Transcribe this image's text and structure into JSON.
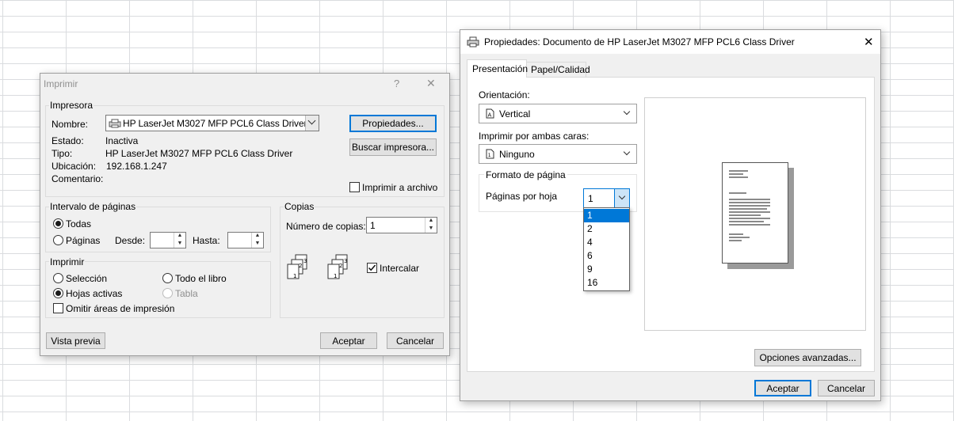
{
  "print_dialog": {
    "title": "Imprimir",
    "help_glyph": "?",
    "close_glyph": "✕",
    "printer": {
      "group_label": "Impresora",
      "name_label": "Nombre:",
      "name_value": "HP LaserJet M3027 MFP PCL6 Class Driver",
      "status_label": "Estado:",
      "status_value": "Inactiva",
      "type_label": "Tipo:",
      "type_value": "HP LaserJet M3027 MFP PCL6 Class Driver",
      "location_label": "Ubicación:",
      "location_value": "192.168.1.247",
      "comment_label": "Comentario:",
      "properties_button": "Propiedades...",
      "find_printer_button": "Buscar impresora...",
      "print_to_file_label": "Imprimir a archivo"
    },
    "page_range": {
      "group_label": "Intervalo de páginas",
      "all_label": "Todas",
      "pages_label": "Páginas",
      "from_label": "Desde:",
      "to_label": "Hasta:",
      "from_value": "",
      "to_value": ""
    },
    "print_what": {
      "group_label": "Imprimir",
      "selection_label": "Selección",
      "entire_workbook_label": "Todo el libro",
      "active_sheets_label": "Hojas activas",
      "table_label": "Tabla",
      "ignore_print_areas_label": "Omitir áreas de impresión"
    },
    "copies": {
      "group_label": "Copias",
      "count_label": "Número de copias:",
      "count_value": "1",
      "collate_label": "Intercalar"
    },
    "buttons": {
      "preview": "Vista previa",
      "ok": "Aceptar",
      "cancel": "Cancelar"
    }
  },
  "properties_dialog": {
    "title": "Propiedades: Documento de HP LaserJet M3027 MFP PCL6 Class Driver",
    "close_glyph": "✕",
    "tabs": [
      {
        "label": "Presentación",
        "active": true
      },
      {
        "label": "Papel/Calidad",
        "active": false
      }
    ],
    "orientation_label": "Orientación:",
    "orientation_value": "Vertical",
    "duplex_label": "Imprimir por ambas caras:",
    "duplex_value": "Ninguno",
    "page_format_label": "Formato de página",
    "pages_per_sheet_label": "Páginas por hoja",
    "pages_per_sheet_value": "1",
    "pages_per_sheet_options": [
      "1",
      "2",
      "4",
      "6",
      "9",
      "16"
    ],
    "advanced_button": "Opciones avanzadas...",
    "ok_button": "Aceptar",
    "cancel_button": "Cancelar"
  },
  "colors": {
    "accent": "#0078d7",
    "dialog_bg": "#f0f0f0",
    "grid_line": "#dadcdf"
  }
}
